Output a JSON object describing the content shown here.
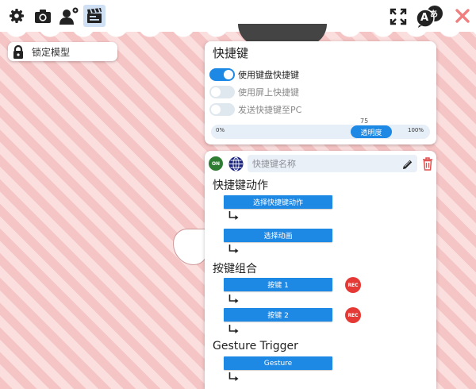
{
  "toolbar": {
    "left_icons": [
      "gear-icon",
      "camera-icon",
      "user-settings-icon",
      "clapperboard-icon"
    ],
    "selected_icon": "clapperboard-icon",
    "right_icons": [
      "fullscreen-icon",
      "language-icon",
      "close-icon"
    ],
    "language_glyphs": {
      "latin": "A",
      "kana": "あ"
    }
  },
  "lock_model": {
    "label": "锁定模型",
    "icon": "lock-icon"
  },
  "shortcut_panel": {
    "title": "快捷键",
    "toggles": [
      {
        "label": "使用键盘快捷键",
        "checked": true
      },
      {
        "label": "使用屏上快捷键",
        "checked": false
      },
      {
        "label": "发送快捷键至PC",
        "checked": false
      }
    ],
    "opacity": {
      "label": "透明度",
      "value": "75",
      "min_label": "0%",
      "max_label": "100%"
    }
  },
  "shortcut_editor": {
    "on_badge": "ON",
    "name_placeholder": "快捷键名称",
    "action_section": {
      "title": "快捷键动作",
      "buttons": [
        "选择快捷键动作",
        "选择动画"
      ]
    },
    "key_combo_section": {
      "title": "按键组合",
      "keys": [
        {
          "label": "按键 1",
          "rec": "REC"
        },
        {
          "label": "按键 2",
          "rec": "REC"
        }
      ]
    },
    "gesture_section": {
      "title": "Gesture Trigger",
      "button": "Gesture"
    }
  },
  "colors": {
    "accent_blue": "#1e88e5",
    "rec_red": "#e53935",
    "on_green": "#2e7d32",
    "close_red": "#f08080",
    "background_stripe_a": "#f5c4c4",
    "background_stripe_b": "#fbdede"
  }
}
